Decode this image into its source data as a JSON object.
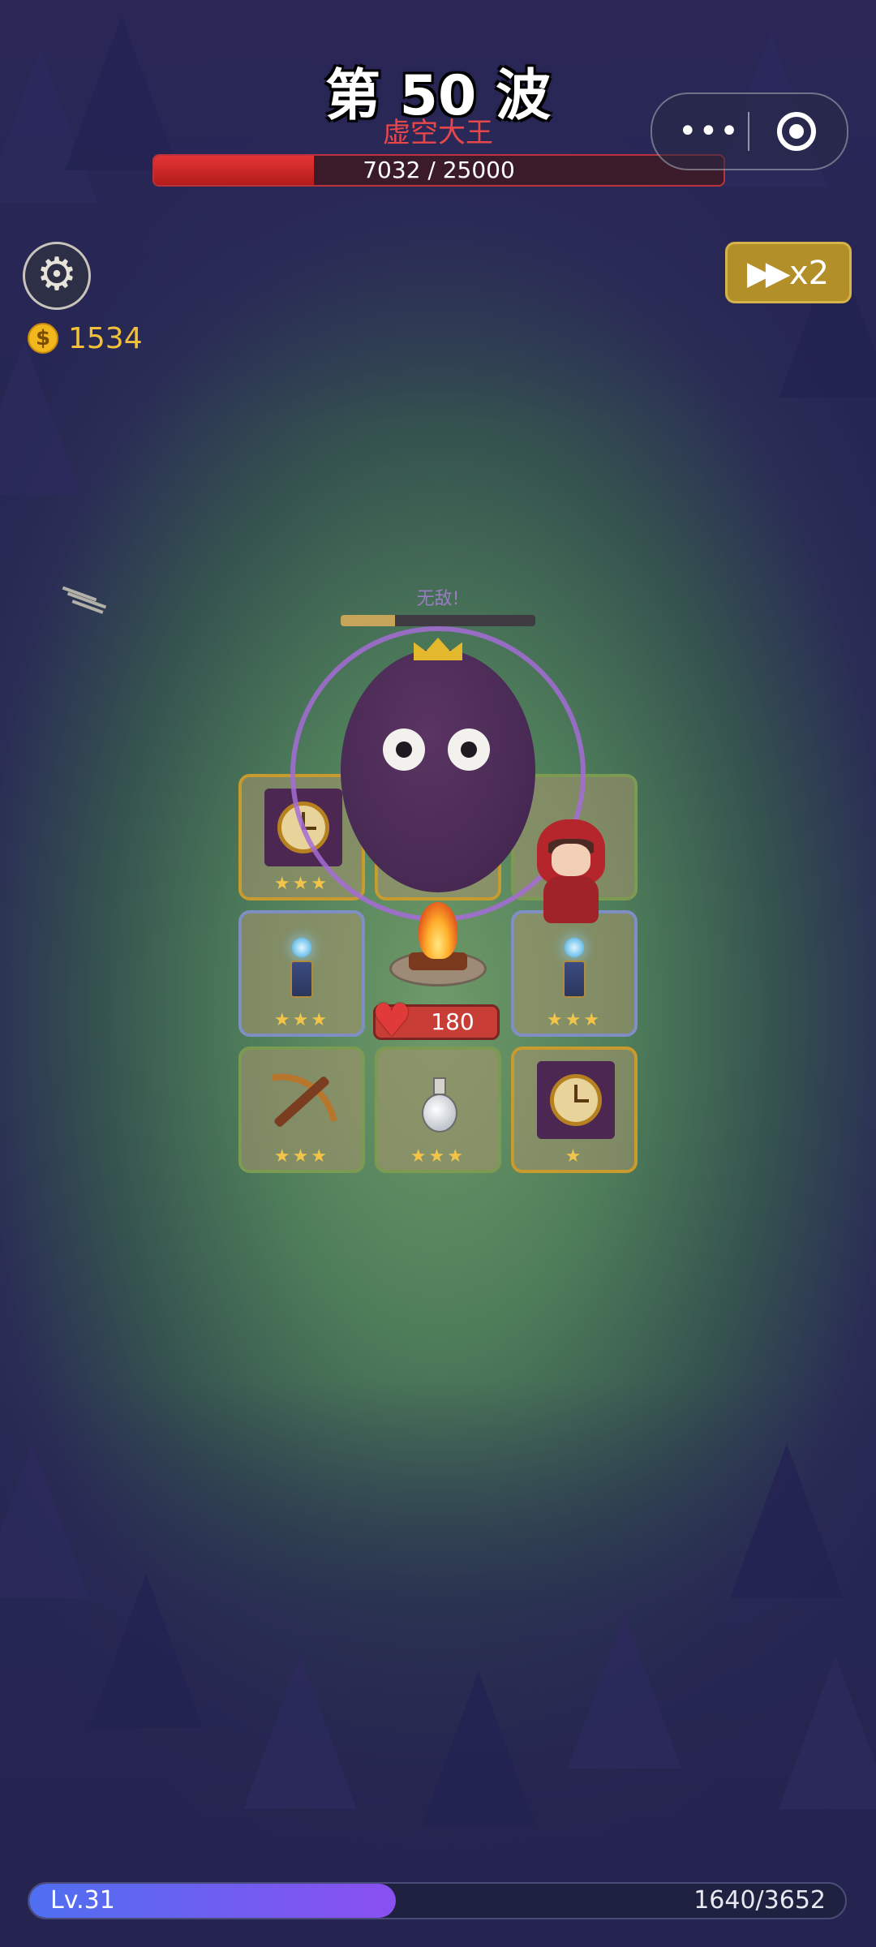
{
  "wave": {
    "title": "第 50 波",
    "boss_name": "虚空大王"
  },
  "boss_hp": {
    "text": "7032 / 25000",
    "current": 7032,
    "max": 25000
  },
  "capsule": {
    "more_label": "•••"
  },
  "coins": {
    "symbol": "$",
    "value": "1534"
  },
  "speed": {
    "icon": "fast-forward",
    "label": "x2"
  },
  "boss": {
    "status": "无敌!",
    "invulnerable_progress": 0.28
  },
  "campfire": {
    "hp": "180"
  },
  "board": {
    "slots": [
      {
        "item": "clock",
        "stars": "★★★",
        "frame": "gold"
      },
      {
        "item": "hidden",
        "stars": "",
        "frame": "gold"
      },
      {
        "item": "hidden",
        "stars": "",
        "frame": "green"
      },
      {
        "item": "tesla-tower",
        "stars": "★★★",
        "frame": "blue"
      },
      {
        "item": "tesla-tower",
        "stars": "★★★",
        "frame": "blue"
      },
      {
        "item": "crossbow",
        "stars": "★★★",
        "frame": "green"
      },
      {
        "item": "potion",
        "stars": "★★★",
        "frame": "green"
      },
      {
        "item": "clock",
        "stars": "★",
        "frame": "gold"
      }
    ]
  },
  "xp": {
    "level": "Lv.31",
    "text": "1640/3652",
    "current": 1640,
    "max": 3652
  },
  "colors": {
    "boss_hp": "#e43434",
    "xp_start": "#4f6ff0",
    "xp_end": "#8a4ff0",
    "coin": "#f3c03a",
    "speed_button": "#b38f2a"
  }
}
